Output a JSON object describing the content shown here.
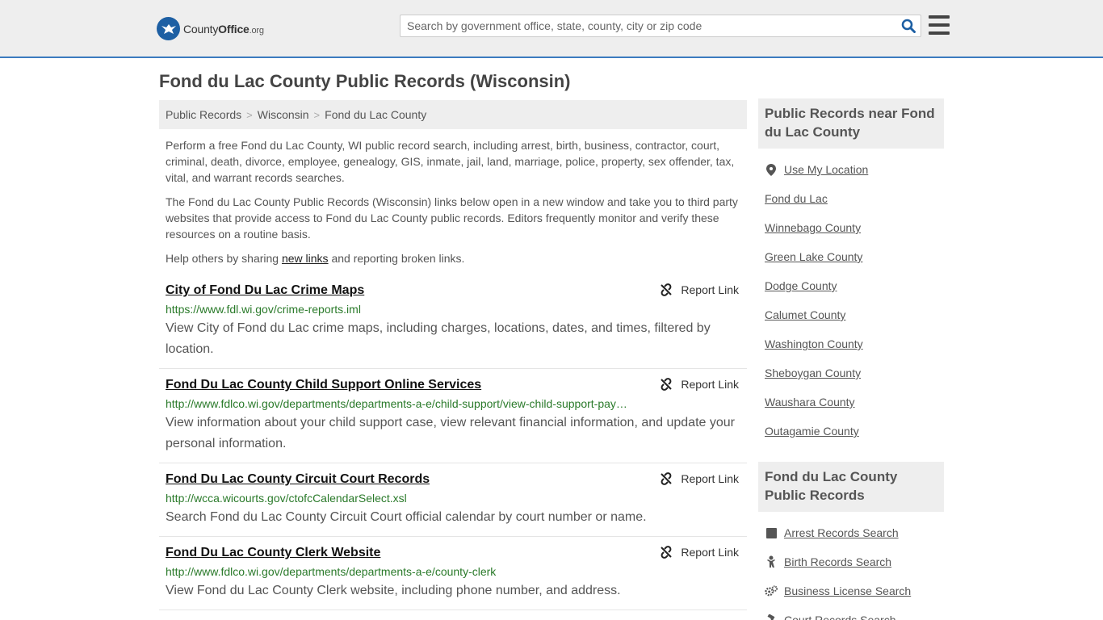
{
  "header": {
    "logo_bold": "County",
    "logo_mid": "Office",
    "logo_org": ".org",
    "search_placeholder": "Search by government office, state, county, city or zip code"
  },
  "page": {
    "title": "Fond du Lac County Public Records (Wisconsin)"
  },
  "breadcrumb": [
    "Public Records",
    "Wisconsin",
    "Fond du Lac County"
  ],
  "intro": {
    "p1": "Perform a free Fond du Lac County, WI public record search, including arrest, birth, business, contractor, court, criminal, death, divorce, employee, genealogy, GIS, inmate, jail, land, marriage, police, property, sex offender, tax, vital, and warrant records searches.",
    "p2": "The Fond du Lac County Public Records (Wisconsin) links below open in a new window and take you to third party websites that provide access to Fond du Lac County public records. Editors frequently monitor and verify these resources on a routine basis.",
    "p3_before": "Help others by sharing ",
    "p3_link": "new links",
    "p3_after": " and reporting broken links."
  },
  "report_label": "Report Link",
  "results": [
    {
      "title": "City of Fond Du Lac Crime Maps",
      "url": "https://www.fdl.wi.gov/crime-reports.iml",
      "desc": "View City of Fond du Lac crime maps, including charges, locations, dates, and times, filtered by location."
    },
    {
      "title": "Fond Du Lac County Child Support Online Services",
      "url": "http://www.fdlco.wi.gov/departments/departments-a-e/child-support/view-child-support-payment-information",
      "desc": "View information about your child support case, view relevant financial information, and update your personal information."
    },
    {
      "title": "Fond Du Lac County Circuit Court Records",
      "url": "http://wcca.wicourts.gov/ctofcCalendarSelect.xsl",
      "desc": "Search Fond du Lac County Circuit Court official calendar by court number or name."
    },
    {
      "title": "Fond Du Lac County Clerk Website",
      "url": "http://www.fdlco.wi.gov/departments/departments-a-e/county-clerk",
      "desc": "View Fond du Lac County Clerk website, including phone number, and address."
    }
  ],
  "sidebar": {
    "near_title": "Public Records near Fond du Lac County",
    "near_items": [
      {
        "label": "Use My Location",
        "icon": "location-pin-icon"
      },
      {
        "label": "Fond du Lac"
      },
      {
        "label": "Winnebago County"
      },
      {
        "label": "Green Lake County"
      },
      {
        "label": "Dodge County"
      },
      {
        "label": "Calumet County"
      },
      {
        "label": "Washington County"
      },
      {
        "label": "Sheboygan County"
      },
      {
        "label": "Waushara County"
      },
      {
        "label": "Outagamie County"
      }
    ],
    "records_title": "Fond du Lac County Public Records",
    "records_items": [
      {
        "label": "Arrest Records Search",
        "icon": "square-icon"
      },
      {
        "label": "Birth Records Search",
        "icon": "baby-icon"
      },
      {
        "label": "Business License Search",
        "icon": "gears-icon"
      },
      {
        "label": "Court Records Search",
        "icon": "gavel-icon"
      }
    ]
  },
  "colors": {
    "accent": "#3b7bbf",
    "logo": "#1d5fa3",
    "url_green": "#2a7a2a",
    "panel_bg": "#eeeeee"
  }
}
